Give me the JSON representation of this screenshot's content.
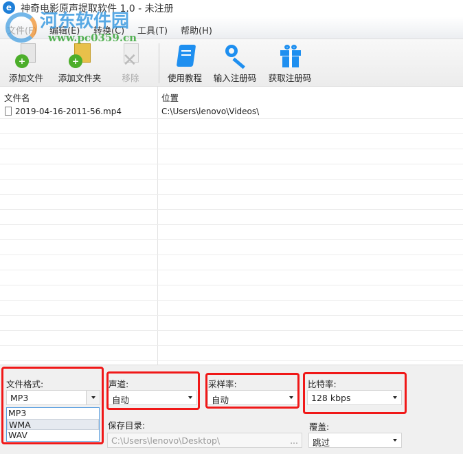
{
  "window": {
    "title": "神奇电影原声提取软件 1.0 - 未注册"
  },
  "menu": [
    {
      "label": "文件(F)"
    },
    {
      "label": "编辑(E)"
    },
    {
      "label": "转换(C)"
    },
    {
      "label": "工具(T)"
    },
    {
      "label": "帮助(H)"
    }
  ],
  "toolbar": {
    "add_file": "添加文件",
    "add_folder": "添加文件夹",
    "remove": "移除",
    "tutorial": "使用教程",
    "enter_code": "输入注册码",
    "get_code": "获取注册码"
  },
  "list": {
    "col_name": "文件名",
    "col_location": "位置",
    "rows": [
      {
        "name": "2019-04-16-2011-56.mp4",
        "location": "C:\\Users\\lenovo\\Videos\\"
      }
    ]
  },
  "settings": {
    "format_label": "文件格式:",
    "format_value": "MP3",
    "format_options": [
      "MP3",
      "WMA",
      "WAV"
    ],
    "channel_label": "声道:",
    "channel_value": "自动",
    "samplerate_label": "采样率:",
    "samplerate_value": "自动",
    "bitrate_label": "比特率:",
    "bitrate_value": "128 kbps",
    "save_label": "保存目录:",
    "save_value": "C:\\Users\\lenovo\\Desktop\\",
    "browse": "...",
    "overwrite_label": "覆盖:",
    "overwrite_value": "跳过"
  },
  "watermark": {
    "name": "河东软件园",
    "url": "www.pc0359.cn"
  }
}
